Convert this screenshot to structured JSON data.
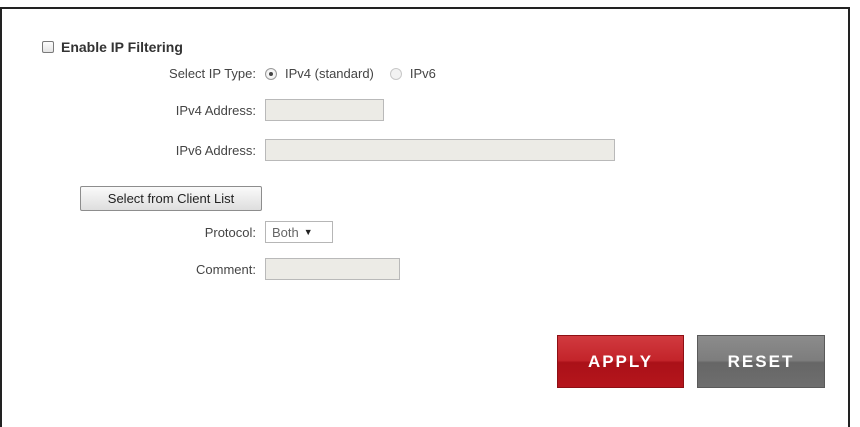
{
  "enable_filtering": {
    "label": "Enable IP Filtering",
    "checked": false
  },
  "ip_type": {
    "label": "Select IP Type:",
    "options": [
      {
        "label": "IPv4 (standard)",
        "selected": true
      },
      {
        "label": "IPv6",
        "selected": false
      }
    ]
  },
  "ipv4": {
    "label": "IPv4 Address:",
    "value": ""
  },
  "ipv6": {
    "label": "IPv6 Address:",
    "value": ""
  },
  "client_list_button": "Select from Client List",
  "protocol": {
    "label": "Protocol:",
    "value": "Both"
  },
  "comment": {
    "label": "Comment:",
    "value": ""
  },
  "buttons": {
    "apply": "APPLY",
    "reset": "RESET"
  },
  "colors": {
    "apply": "#c3242a",
    "reset": "#7d7d7d"
  }
}
